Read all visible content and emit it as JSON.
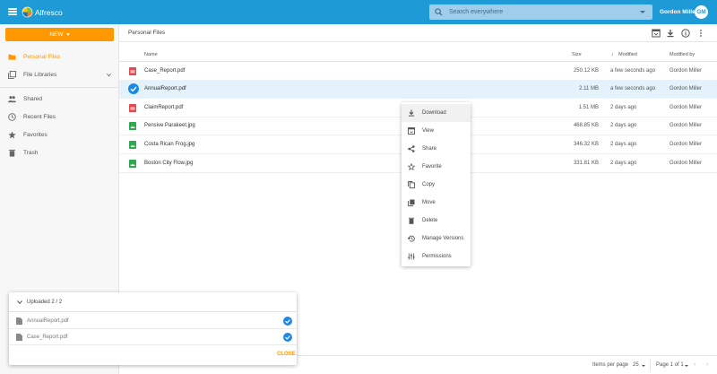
{
  "app": {
    "brand": "Alfresco",
    "search_placeholder": "Search everywhere",
    "user_name": "Gordon Miller",
    "user_initials": "GM",
    "accent_color": "#1e9bd7",
    "new_button_color": "#ff9800"
  },
  "sidebar": {
    "new_label": "NEW",
    "items": [
      {
        "label": "Personal Files",
        "icon": "folder-icon",
        "active": true
      },
      {
        "label": "File Libraries",
        "icon": "library-icon"
      },
      {
        "label": "Shared",
        "icon": "people-icon"
      },
      {
        "label": "Recent Files",
        "icon": "clock-icon"
      },
      {
        "label": "Favorites",
        "icon": "star-icon"
      },
      {
        "label": "Trash",
        "icon": "trash-icon"
      }
    ]
  },
  "main": {
    "breadcrumb": "Personal Files",
    "columns": {
      "name": "Name",
      "size": "Size",
      "modified": "Modified",
      "modified_by": "Modified by"
    },
    "files": [
      {
        "name": "Case_Report.pdf",
        "size": "250.12 KB",
        "modified": "a few seconds ago",
        "modified_by": "Gordon Miller",
        "type": "pdf"
      },
      {
        "name": "AnnualReport.pdf",
        "size": "2.11 MB",
        "modified": "a few seconds ago",
        "modified_by": "Gordon Miller",
        "type": "pdf",
        "selected": true
      },
      {
        "name": "ClaimReport.pdf",
        "size": "1.51 MB",
        "modified": "2 days ago",
        "modified_by": "Gordon Miller",
        "type": "pdf"
      },
      {
        "name": "Pensive Parakeet.jpg",
        "size": "468.85 KB",
        "modified": "2 days ago",
        "modified_by": "Gordon Miller",
        "type": "image"
      },
      {
        "name": "Costa Rican Frog.jpg",
        "size": "346.32 KB",
        "modified": "2 days ago",
        "modified_by": "Gordon Miller",
        "type": "image"
      },
      {
        "name": "Boston City Flow.jpg",
        "size": "331.81 KB",
        "modified": "2 days ago",
        "modified_by": "Gordon Miller",
        "type": "image"
      }
    ]
  },
  "context_menu": {
    "items": [
      {
        "label": "Download",
        "icon": "download-icon"
      },
      {
        "label": "View",
        "icon": "view-icon"
      },
      {
        "label": "Share",
        "icon": "share-icon"
      },
      {
        "label": "Favorite",
        "icon": "star-outline-icon"
      },
      {
        "label": "Copy",
        "icon": "copy-icon"
      },
      {
        "label": "Move",
        "icon": "move-icon"
      },
      {
        "label": "Delete",
        "icon": "delete-icon"
      },
      {
        "label": "Manage Versions",
        "icon": "history-icon"
      },
      {
        "label": "Permissions",
        "icon": "permissions-icon"
      }
    ]
  },
  "upload_panel": {
    "title": "Uploaded 2 / 2",
    "files": [
      {
        "name": "AnnualReport.pdf"
      },
      {
        "name": "Case_Report.pdf"
      }
    ],
    "close_label": "CLOSE"
  },
  "pagination": {
    "items_per_page_label": "Items per page",
    "items_per_page_value": "25",
    "page_label": "Page 1 of 1"
  }
}
